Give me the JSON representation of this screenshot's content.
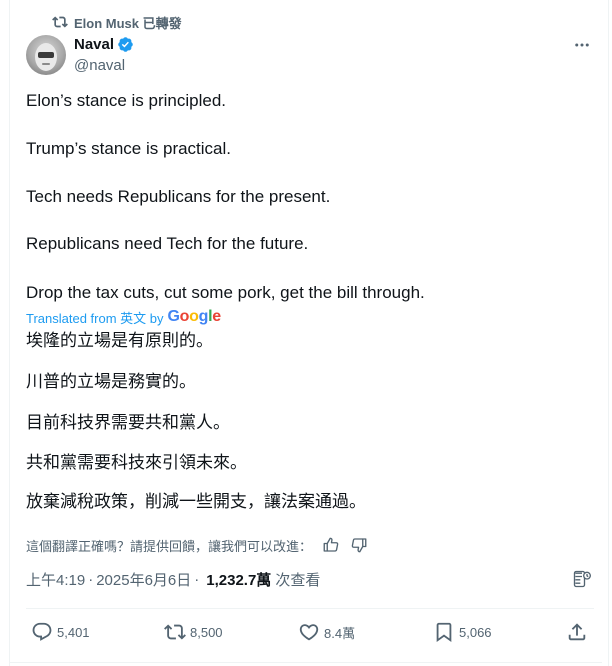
{
  "repost": {
    "text": "Elon Musk 已轉發",
    "icon": "repost-icon"
  },
  "author": {
    "name": "Naval",
    "handle": "@naval",
    "verified_color": "#1d9bf0"
  },
  "tweet": {
    "lines": [
      "Elon’s stance is principled.",
      "Trump’s stance is practical.",
      "Tech needs Republicans for the present.",
      "Republicans need Tech for the future.",
      "Drop the tax cuts, cut some pork, get the bill through."
    ]
  },
  "translation": {
    "label": "Translated from 英文 by",
    "provider": "Google",
    "lines": [
      "埃隆的立場是有原則的。",
      "川普的立場是務實的。",
      "目前科技界需要共和黨人。",
      "共和黨需要科技來引領未來。",
      "放棄減稅政策，削減一些開支，讓法案通過。"
    ],
    "feedback_prompt": "這個翻譯正確嗎？請提供回饋，讓我們可以改進："
  },
  "meta": {
    "time": "上午4:19",
    "separator": "·",
    "date": "2025年6月6日",
    "views": "1,232.7萬",
    "views_label": "次查看"
  },
  "actions": {
    "replies": "5,401",
    "reposts": "8,500",
    "likes": "8.4萬",
    "bookmarks": "5,066"
  },
  "colors": {
    "accent": "#1d9bf0",
    "muted": "#536471",
    "text": "#0f1419"
  }
}
